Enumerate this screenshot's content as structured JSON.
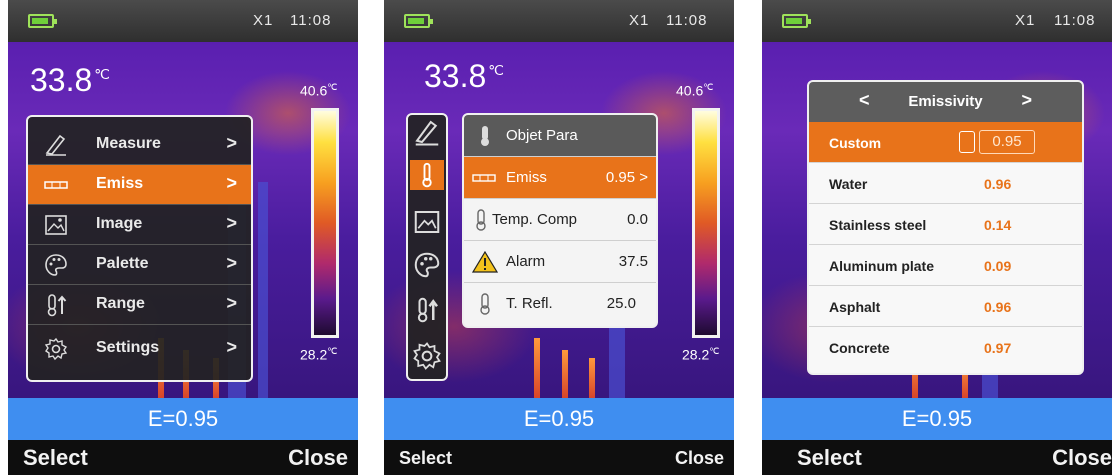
{
  "status": {
    "zoom": "X1",
    "time": "11:08"
  },
  "measurement": {
    "center_temp": "33.8",
    "unit": "℃",
    "scale_max": "40.6",
    "scale_min": "28.2",
    "emissivity_bar": "E=0.95"
  },
  "softkeys": {
    "left": "Select",
    "right": "Close"
  },
  "main_menu": {
    "items": [
      {
        "label": "Measure",
        "icon": "measure-icon"
      },
      {
        "label": "Emiss",
        "icon": "emissivity-icon",
        "selected": true
      },
      {
        "label": "Image",
        "icon": "image-icon"
      },
      {
        "label": "Palette",
        "icon": "palette-icon"
      },
      {
        "label": "Range",
        "icon": "range-icon"
      },
      {
        "label": "Settings",
        "icon": "gear-icon"
      }
    ]
  },
  "object_params": {
    "header": "Objet Para",
    "rows": [
      {
        "label": "Emiss",
        "value": "0.95",
        "suffix": ">",
        "selected": true
      },
      {
        "label": "Temp. Comp",
        "value": "0.0"
      },
      {
        "label": "Alarm",
        "value": "37.5"
      },
      {
        "label": "T. Refl.",
        "value": "25.0"
      }
    ]
  },
  "emissivity_list": {
    "title": "Emissivity",
    "custom": {
      "label": "Custom",
      "value": "0.95"
    },
    "materials": [
      {
        "name": "Water",
        "value": "0.96"
      },
      {
        "name": "Stainless steel",
        "value": "0.14"
      },
      {
        "name": "Aluminum plate",
        "value": "0.09"
      },
      {
        "name": "Asphalt",
        "value": "0.96"
      },
      {
        "name": "Concrete",
        "value": "0.97"
      }
    ]
  },
  "colors": {
    "accent": "#e8731a",
    "ebar": "#3f8ef0",
    "battery": "#6fd03a"
  }
}
